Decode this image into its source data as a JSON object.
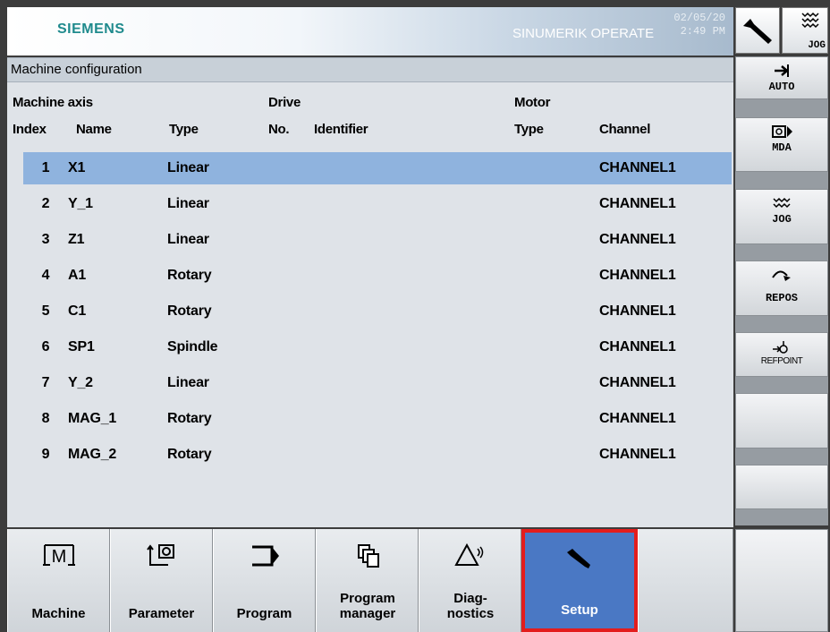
{
  "header": {
    "brand": "SIEMENS",
    "product": "SINUMERIK OPERATE",
    "date": "02/05/20",
    "time": "2:49 PM"
  },
  "title": "Machine configuration",
  "table": {
    "group_headers": {
      "axis": "Machine axis",
      "drive": "Drive",
      "motor": "Motor"
    },
    "columns": {
      "index": "Index",
      "name": "Name",
      "type": "Type",
      "no": "No.",
      "identifier": "Identifier",
      "motor_type": "Type",
      "channel": "Channel"
    },
    "rows": [
      {
        "index": "1",
        "name": "X1",
        "type": "Linear",
        "channel": "CHANNEL1",
        "selected": true
      },
      {
        "index": "2",
        "name": "Y_1",
        "type": "Linear",
        "channel": "CHANNEL1"
      },
      {
        "index": "3",
        "name": "Z1",
        "type": "Linear",
        "channel": "CHANNEL1"
      },
      {
        "index": "4",
        "name": "A1",
        "type": "Rotary",
        "channel": "CHANNEL1"
      },
      {
        "index": "5",
        "name": "C1",
        "type": "Rotary",
        "channel": "CHANNEL1"
      },
      {
        "index": "6",
        "name": "SP1",
        "type": "Spindle",
        "channel": "CHANNEL1"
      },
      {
        "index": "7",
        "name": "Y_2",
        "type": "Linear",
        "channel": "CHANNEL1"
      },
      {
        "index": "8",
        "name": "MAG_1",
        "type": "Rotary",
        "channel": "CHANNEL1"
      },
      {
        "index": "9",
        "name": "MAG_2",
        "type": "Rotary",
        "channel": "CHANNEL1"
      }
    ]
  },
  "bottom_softkeys": [
    {
      "label": "Machine",
      "icon": "machine-icon"
    },
    {
      "label": "Parameter",
      "icon": "parameter-icon"
    },
    {
      "label": "Program",
      "icon": "program-icon"
    },
    {
      "label": "Program manager",
      "icon": "program-manager-icon"
    },
    {
      "label": "Diag-nostics",
      "icon": "diagnostics-icon"
    },
    {
      "label": "Setup",
      "icon": "wrench-icon",
      "active": true
    }
  ],
  "right_softkeys": [
    {
      "label": "AUTO",
      "icon": "auto-icon"
    },
    {
      "label": "MDA",
      "icon": "mda-icon"
    },
    {
      "label": "JOG",
      "icon": "jog-icon"
    },
    {
      "label": "REPOS",
      "icon": "repos-icon"
    },
    {
      "label": "REFPOINT",
      "icon": "refpoint-icon"
    }
  ],
  "top_buttons": {
    "jog_label": "JOG"
  },
  "colors": {
    "selection": "#8fb3de",
    "active_softkey": "#4a78c4",
    "active_border": "#e31d1d",
    "brand": "#1f8a8d"
  }
}
